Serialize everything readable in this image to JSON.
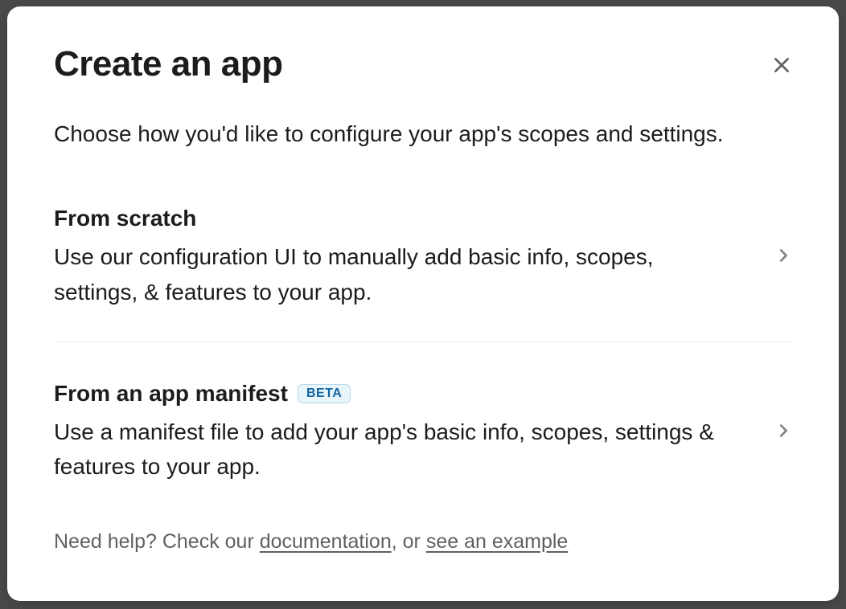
{
  "modal": {
    "title": "Create an app",
    "subtitle": "Choose how you'd like to configure your app's scopes and settings."
  },
  "options": [
    {
      "title": "From scratch",
      "description": "Use our configuration UI to manually add basic info, scopes, settings, & features to your app.",
      "badge": null
    },
    {
      "title": "From an app manifest",
      "description": "Use a manifest file to add your app's basic info, scopes, settings & features to your app.",
      "badge": "BETA"
    }
  ],
  "help": {
    "prefix": "Need help? Check our ",
    "link1": "documentation",
    "middle": ", or ",
    "link2": "see an example"
  }
}
